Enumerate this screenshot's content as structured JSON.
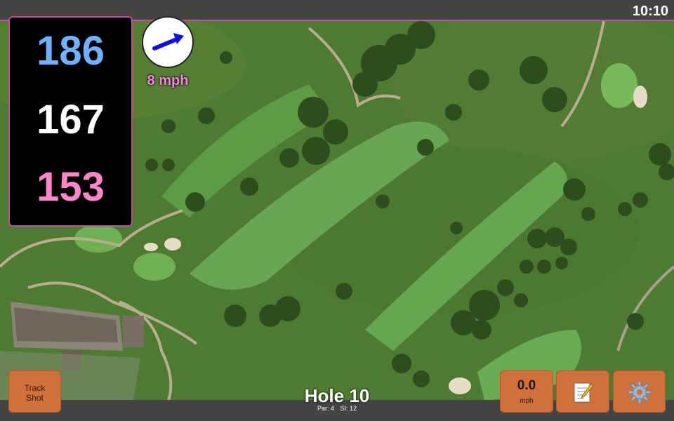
{
  "status_bar": {
    "time": "10:10"
  },
  "distances": {
    "back": "186",
    "middle": "167",
    "front": "153"
  },
  "wind": {
    "speed": "8 mph",
    "arrow_icon": "wind-direction-arrow-icon"
  },
  "hole": {
    "title": "Hole 10",
    "par": "Par: 4",
    "stroke_index": "SI: 12"
  },
  "buttons": {
    "track_shot_line1": "Track",
    "track_shot_line2": "Shot",
    "speed_value": "0.0",
    "speed_unit": "mph",
    "notes_icon": "notepad-icon",
    "settings_icon": "gear-icon"
  },
  "colors": {
    "back_distance": "#6fb2ff",
    "middle_distance": "#ffffff",
    "front_distance": "#ff86c8",
    "button": "#d0703a",
    "accent_border": "#c44aa6"
  }
}
